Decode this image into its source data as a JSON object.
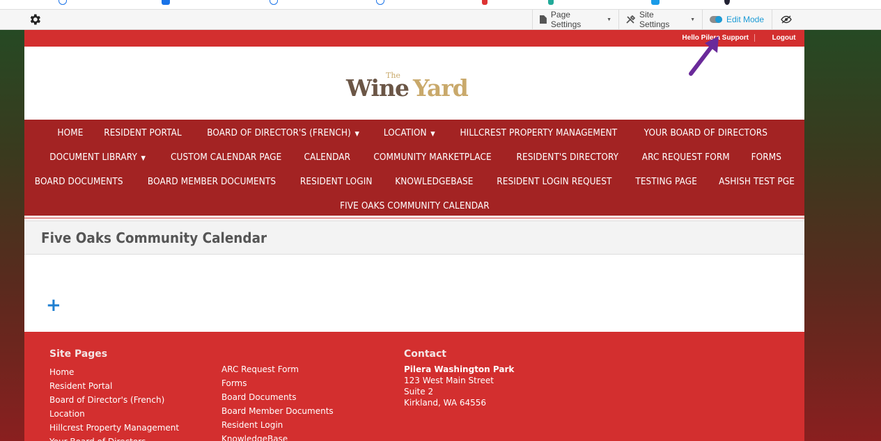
{
  "admin_bar": {
    "page_settings": "Page Settings",
    "site_settings": "Site Settings",
    "edit_mode": "Edit Mode"
  },
  "topbar": {
    "hello": "Hello Pilera Support",
    "logout": "Logout"
  },
  "logo": {
    "the": "The",
    "wine": "Wine",
    "yard": "Yard"
  },
  "nav": {
    "rows": [
      [
        {
          "label": "HOME",
          "dropdown": false
        },
        {
          "label": "RESIDENT PORTAL",
          "dropdown": false
        },
        {
          "label": "BOARD OF DIRECTOR'S (FRENCH)",
          "dropdown": true
        },
        {
          "label": "LOCATION",
          "dropdown": true
        },
        {
          "label": "HILLCREST PROPERTY MANAGEMENT",
          "dropdown": false
        },
        {
          "label": "YOUR BOARD OF DIRECTORS",
          "dropdown": false
        }
      ],
      [
        {
          "label": "DOCUMENT LIBRARY",
          "dropdown": true
        },
        {
          "label": "CUSTOM CALENDAR PAGE",
          "dropdown": false
        },
        {
          "label": "CALENDAR",
          "dropdown": false
        },
        {
          "label": "COMMUNITY MARKETPLACE",
          "dropdown": false
        },
        {
          "label": "RESIDENT'S DIRECTORY",
          "dropdown": false
        },
        {
          "label": "ARC REQUEST FORM",
          "dropdown": false
        },
        {
          "label": "FORMS",
          "dropdown": false
        }
      ],
      [
        {
          "label": "BOARD DOCUMENTS",
          "dropdown": false
        },
        {
          "label": "BOARD MEMBER DOCUMENTS",
          "dropdown": false
        },
        {
          "label": "RESIDENT LOGIN",
          "dropdown": false
        },
        {
          "label": "KNOWLEDGEBASE",
          "dropdown": false
        },
        {
          "label": "RESIDENT LOGIN REQUEST",
          "dropdown": false
        },
        {
          "label": "TESTING PAGE",
          "dropdown": false
        },
        {
          "label": "ASHISH TEST PGE",
          "dropdown": false
        }
      ],
      [
        {
          "label": "FIVE OAKS COMMUNITY CALENDAR",
          "dropdown": false
        }
      ]
    ]
  },
  "page": {
    "title": "Five Oaks Community Calendar",
    "add_symbol": "+"
  },
  "footer": {
    "site_pages_heading": "Site Pages",
    "col1": [
      "Home",
      "Resident Portal",
      "Board of Director's (French)",
      "Location",
      "Hillcrest Property Management",
      "Your Board of Directors"
    ],
    "col2": [
      "ARC Request Form",
      "Forms",
      "Board Documents",
      "Board Member Documents",
      "Resident Login",
      "KnowledgeBase"
    ],
    "contact_heading": "Contact",
    "contact": {
      "name": "Pilera Washington Park",
      "street": "123 West Main Street",
      "suite": "Suite 2",
      "city": "Kirkland, WA 64556"
    }
  },
  "colors": {
    "brand_red": "#d32f2f",
    "nav_red": "#a32323",
    "edit_blue": "#1c9bd6",
    "annotation_purple": "#6a2a9a"
  }
}
